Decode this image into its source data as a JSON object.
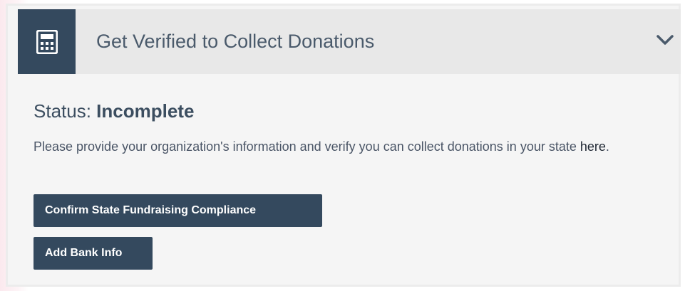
{
  "panel": {
    "title": "Get Verified to Collect Donations",
    "icon": "calculator-icon",
    "toggle_icon": "chevron-down-icon"
  },
  "status": {
    "label": "Status:",
    "value": "Incomplete"
  },
  "description": {
    "text": "Please provide your organization's information and verify you can collect donations in your state ",
    "link_text": "here",
    "trailing": "."
  },
  "buttons": {
    "compliance_label": "Confirm State Fundraising Compliance",
    "bank_label": "Add Bank Info"
  },
  "colors": {
    "accent": "#34495e",
    "header_bg": "#e8e8e8",
    "panel_bg": "#f5f5f5"
  }
}
